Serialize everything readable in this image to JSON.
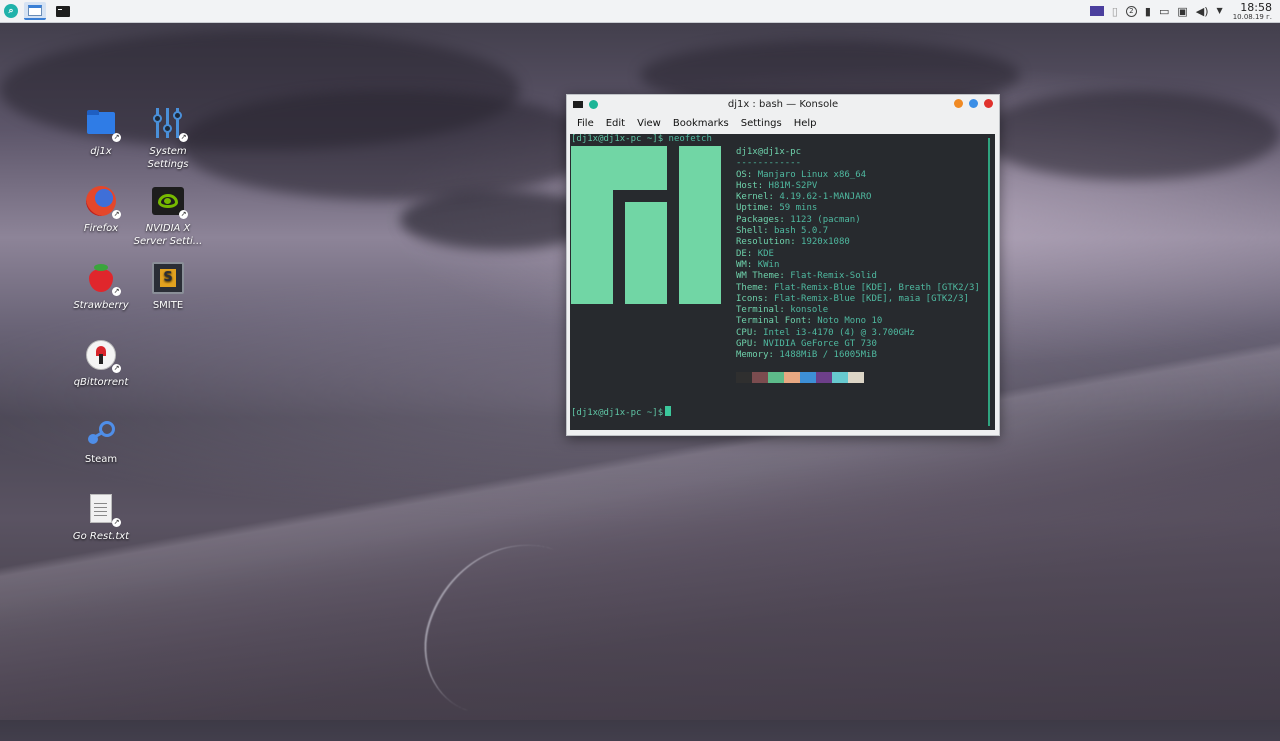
{
  "panel": {
    "launcher_icon": "search-icon",
    "tasks": [
      {
        "name": "dolphin",
        "icon": "folder-window-icon",
        "active": true
      },
      {
        "name": "konsole",
        "icon": "terminal-icon",
        "active": false
      }
    ],
    "tray": {
      "notification_count": "2",
      "clock_time": "18:58",
      "clock_date": "10.08.19 г."
    }
  },
  "desktop": {
    "icons": [
      {
        "label": "dj1x",
        "icon": "folder-icon"
      },
      {
        "label": "System Settings",
        "icon": "settings-icon"
      },
      {
        "label": "Firefox",
        "icon": "firefox-icon"
      },
      {
        "label": "NVIDIA X Server Setti...",
        "icon": "nvidia-icon"
      },
      {
        "label": "Strawberry",
        "icon": "strawberry-icon"
      },
      {
        "label": "SMITE",
        "icon": "smite-icon"
      },
      {
        "label": "qBittorrent",
        "icon": "qbittorrent-icon"
      },
      {
        "label": "Steam",
        "icon": "steam-icon"
      },
      {
        "label": "Go Rest.txt",
        "icon": "text-file-icon"
      }
    ]
  },
  "konsole": {
    "title": "dj1x : bash — Konsole",
    "menu": [
      "File",
      "Edit",
      "View",
      "Bookmarks",
      "Settings",
      "Help"
    ],
    "prompt": "[dj1x@dj1x-pc ~]$",
    "command": "neofetch",
    "neofetch": {
      "header": "dj1x@dj1x-pc",
      "separator": "------------",
      "lines": [
        {
          "key": "OS",
          "value": "Manjaro Linux x86_64"
        },
        {
          "key": "Host",
          "value": "H81M-S2PV"
        },
        {
          "key": "Kernel",
          "value": "4.19.62-1-MANJARO"
        },
        {
          "key": "Uptime",
          "value": "59 mins"
        },
        {
          "key": "Packages",
          "value": "1123 (pacman)"
        },
        {
          "key": "Shell",
          "value": "bash 5.0.7"
        },
        {
          "key": "Resolution",
          "value": "1920x1080"
        },
        {
          "key": "DE",
          "value": "KDE"
        },
        {
          "key": "WM",
          "value": "KWin"
        },
        {
          "key": "WM Theme",
          "value": "Flat-Remix-Solid"
        },
        {
          "key": "Theme",
          "value": "Flat-Remix-Blue [KDE], Breath [GTK2/3]"
        },
        {
          "key": "Icons",
          "value": "Flat-Remix-Blue [KDE], maia [GTK2/3]"
        },
        {
          "key": "Terminal",
          "value": "konsole"
        },
        {
          "key": "Terminal Font",
          "value": "Noto Mono 10"
        },
        {
          "key": "CPU",
          "value": "Intel i3-4170 (4) @ 3.700GHz"
        },
        {
          "key": "GPU",
          "value": "NVIDIA GeForce GT 730"
        },
        {
          "key": "Memory",
          "value": "1488MiB / 16005MiB"
        }
      ],
      "palette": [
        "#2f2f2f",
        "#7b4c4f",
        "#5dbb8a",
        "#e8a882",
        "#3d8fd6",
        "#6d3f8a",
        "#67c9cf",
        "#dcd5c6"
      ]
    },
    "prompt2": "[dj1x@dj1x-pc ~]$"
  },
  "colors": {
    "terminal_bg": "#272a2e",
    "terminal_fg": "#4fb9a0",
    "manjaro_green": "#71d6a5"
  }
}
